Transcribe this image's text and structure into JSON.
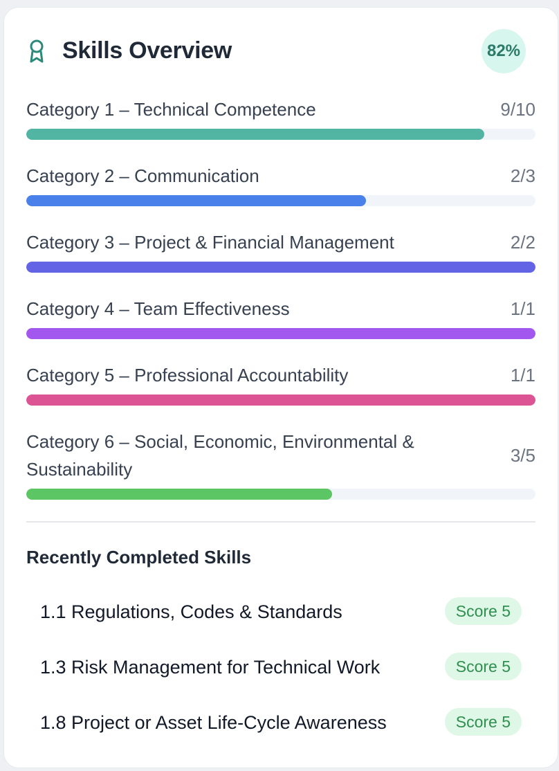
{
  "header": {
    "title": "Skills Overview",
    "overall_percent": "82%",
    "icon": "award-ribbon-icon",
    "accent": "#2b7a6a"
  },
  "categories": [
    {
      "label": "Category 1 – Technical Competence",
      "count": "9/10",
      "progress": 0.9,
      "color": "#52b5a4"
    },
    {
      "label": "Category 2 – Communication",
      "count": "2/3",
      "progress": 0.6667,
      "color": "#4a80ea"
    },
    {
      "label": "Category 3 – Project & Financial Management",
      "count": "2/2",
      "progress": 1.0,
      "color": "#6363e6"
    },
    {
      "label": "Category 4 – Team Effectiveness",
      "count": "1/1",
      "progress": 1.0,
      "color": "#a258ee"
    },
    {
      "label": "Category 5 – Professional Accountability",
      "count": "1/1",
      "progress": 1.0,
      "color": "#dd5494"
    },
    {
      "label": "Category 6 – Social, Economic, Environmental & Sustainability",
      "count": "3/5",
      "progress": 0.6,
      "color": "#5cc564"
    }
  ],
  "recent": {
    "title": "Recently Completed Skills",
    "items": [
      {
        "label": "1.1 Regulations, Codes & Standards",
        "score": "Score 5"
      },
      {
        "label": "1.3 Risk Management for Technical Work",
        "score": "Score 5"
      },
      {
        "label": "1.8 Project or Asset Life-Cycle Awareness",
        "score": "Score 5"
      }
    ]
  }
}
